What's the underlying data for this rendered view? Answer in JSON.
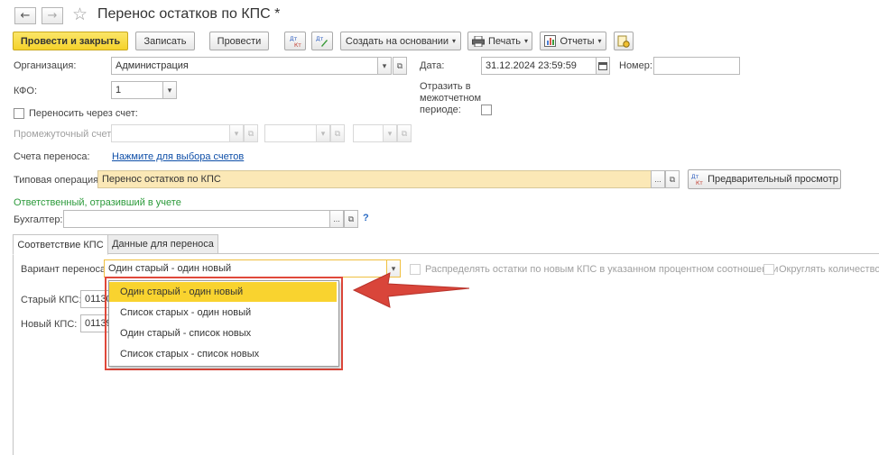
{
  "window": {
    "title": "Перенос остатков по КПС *"
  },
  "nav": {
    "back": "←",
    "forward": "→",
    "star": "☆"
  },
  "toolbar": {
    "post_close": "Провести и закрыть",
    "save": "Записать",
    "post": "Провести",
    "create_based": "Создать на основании",
    "print": "Печать",
    "reports": "Отчеты",
    "caret": "▾"
  },
  "form": {
    "organization_label": "Организация:",
    "organization_value": "Администрация",
    "date_label": "Дата:",
    "date_value": "31.12.2024 23:59:59",
    "number_label": "Номер:",
    "number_value": "",
    "kfo_label": "КФО:",
    "kfo_value": "1",
    "reflect_label_1": "Отразить в",
    "reflect_label_2": "межотчетном",
    "reflect_label_3": "периоде:",
    "transfer_via_account_label": "Переносить через счет:",
    "intermediate_account_label": "Промежуточный счет:",
    "transfer_accounts_label": "Счета переноса:",
    "transfer_accounts_link": "Нажмите для выбора счетов",
    "typical_operation_label": "Типовая операция:",
    "typical_operation_value": "Перенос остатков по КПС",
    "preview_button": "Предварительный просмотр",
    "responsible_heading": "Ответственный, отразивший в учете",
    "accountant_label": "Бухгалтер:",
    "accountant_value": "",
    "help": "?",
    "ellipsis": "...",
    "open": "⧉",
    "arrow_down": "▾"
  },
  "tabs": [
    {
      "label": "Соответствие КПС"
    },
    {
      "label": "Данные для переноса"
    }
  ],
  "kps_tab": {
    "variant_label": "Вариант переноса:",
    "variant_value": "Один старый - один новый",
    "distribute_label": "Распределять остатки по новым КПС в указанном процентном соотношении",
    "round_label": "Округлять количество",
    "old_kps_label": "Старый КПС:",
    "old_kps_value": "01130",
    "new_kps_label": "Новый КПС:",
    "new_kps_value": "01139",
    "dropdown_options": [
      "Один старый - один новый",
      "Список старых - один новый",
      "Один старый - список новых",
      "Список старых - список новых"
    ],
    "selected_index": 0
  },
  "colors": {
    "primary_button": "#f5d22b",
    "selected_option": "#f9d32f",
    "highlight_frame": "#e0483a",
    "arrow": "#d9453a",
    "link": "#0f4fa8",
    "green_heading": "#2b9a3a"
  }
}
